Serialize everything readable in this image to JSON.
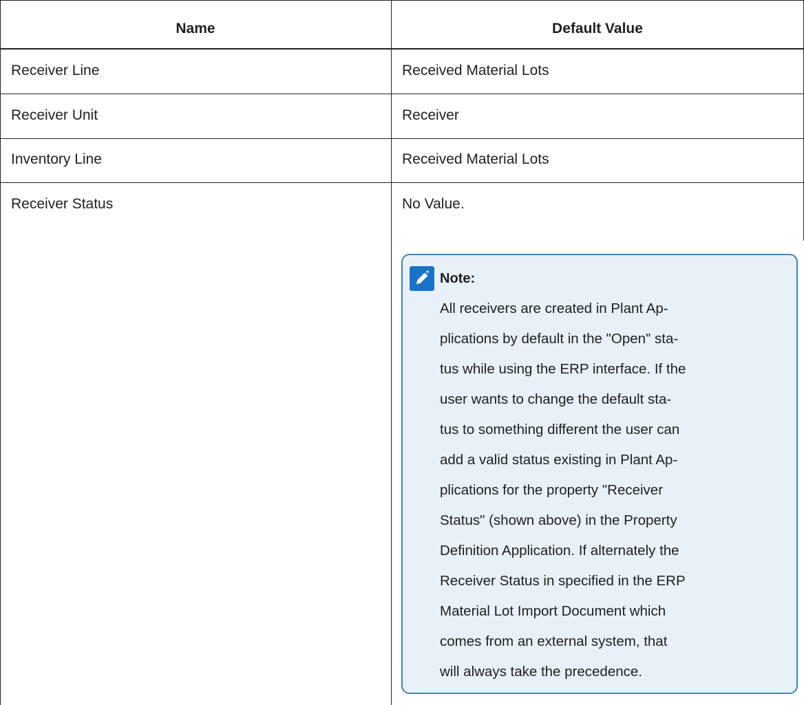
{
  "table": {
    "headers": [
      "Name",
      "Default Value"
    ],
    "rows": [
      {
        "name": "Receiver Line",
        "value": "Received Material Lots"
      },
      {
        "name": "Receiver Unit",
        "value": "Receiver"
      },
      {
        "name": "Inventory Line",
        "value": "Received Material Lots"
      },
      {
        "name": "Receiver Status",
        "value": "No Value."
      }
    ]
  },
  "note": {
    "icon": "pencil-icon",
    "title": "Note:",
    "lines": [
      "All receivers are created in Plant Ap-",
      "plications by default in the \"Open\" sta-",
      "tus while using the ERP interface. If the",
      "user wants to change the default sta-",
      "tus to something different the user can",
      "add a valid status existing in Plant Ap-",
      "plications for the property \"Receiver",
      "Status\" (shown above) in the Property",
      "Definition Application. If alternately the",
      "Receiver Status in specified in the ERP",
      "Material Lot Import Document which",
      "comes from an external system, that",
      "will always take the precedence."
    ],
    "colors": {
      "background": "#e8f1f8",
      "border": "#3b86b8",
      "icon": "#1a73c8"
    }
  }
}
